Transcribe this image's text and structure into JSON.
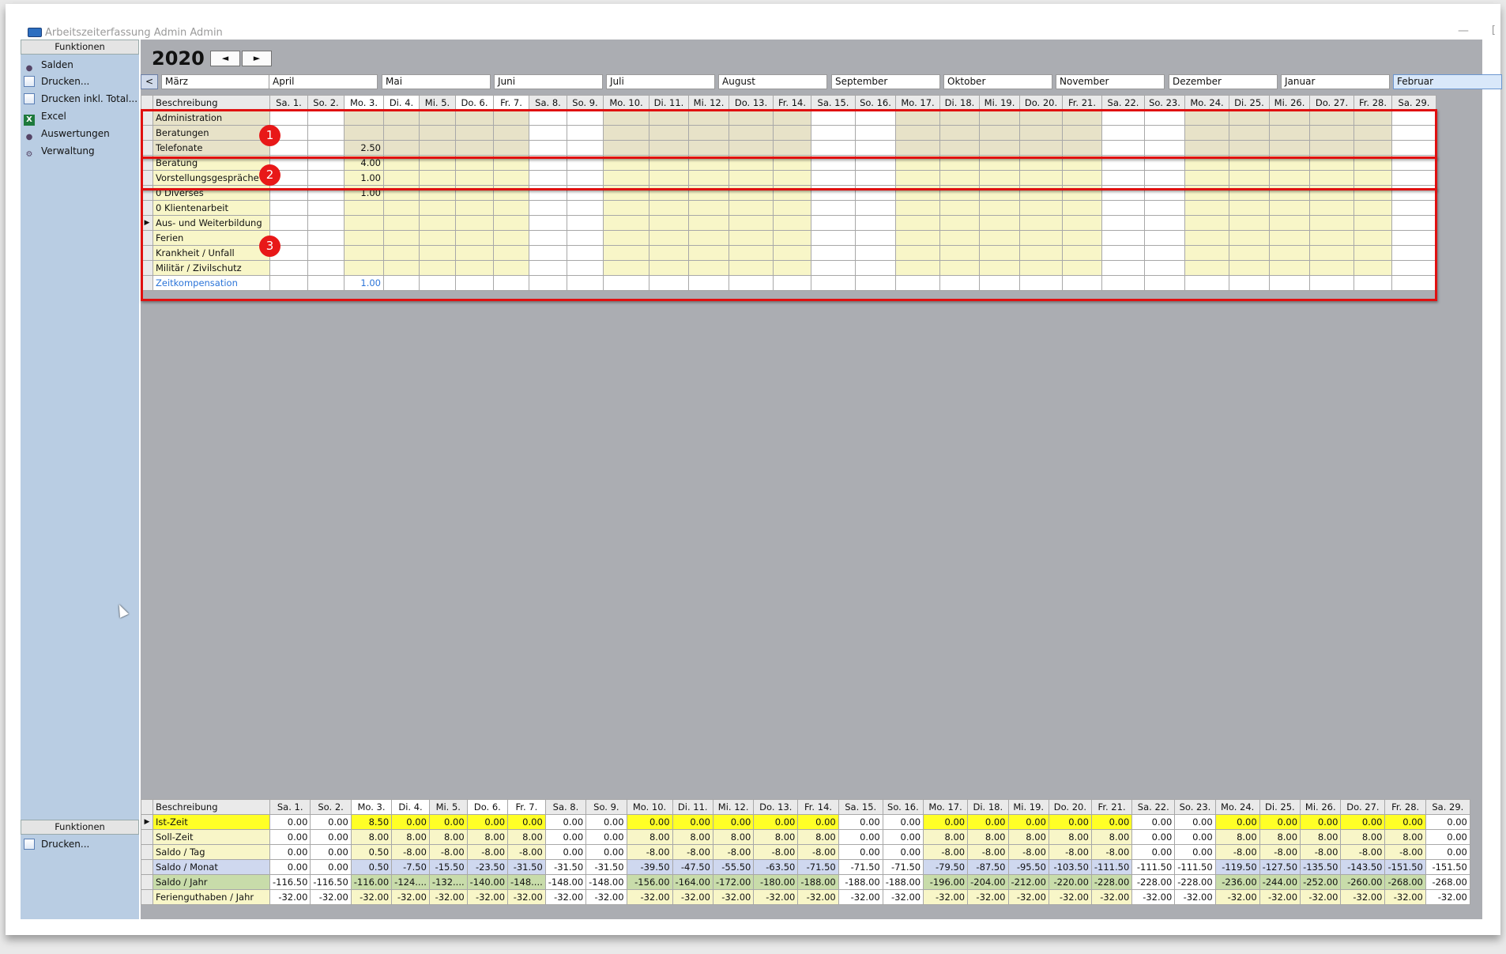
{
  "window": {
    "title": "Arbeitszeiterfassung Admin Admin",
    "minimize": "—",
    "corner": "["
  },
  "sidebar": {
    "header": "Funktionen",
    "items": [
      {
        "label": "Salden",
        "icon": "person-icon"
      },
      {
        "label": "Drucken...",
        "icon": "document-icon"
      },
      {
        "label": "Drucken inkl. Total...",
        "icon": "document-icon"
      },
      {
        "label": "Excel",
        "icon": "excel-icon"
      },
      {
        "label": "Auswertungen",
        "icon": "person-icon"
      },
      {
        "label": "Verwaltung",
        "icon": "gear-icon"
      }
    ],
    "bottom_header": "Funktionen",
    "bottom_items": [
      {
        "label": "Drucken...",
        "icon": "document-icon"
      }
    ]
  },
  "toolbar": {
    "year": "2020",
    "prev_label": "◄",
    "next_label": "►",
    "month_prev_label": "<"
  },
  "months": [
    "März",
    "April",
    "Mai",
    "Juni",
    "Juli",
    "August",
    "September",
    "Oktober",
    "November",
    "Dezember",
    "Januar",
    "Februar"
  ],
  "active_month": "Februar",
  "days": [
    "Sa. 1.",
    "So. 2.",
    "Mo. 3.",
    "Di. 4.",
    "Mi. 5.",
    "Do. 6.",
    "Fr. 7.",
    "Sa. 8.",
    "So. 9.",
    "Mo. 10.",
    "Di. 11.",
    "Mi. 12.",
    "Do. 13.",
    "Fr. 14.",
    "Sa. 15.",
    "So. 16.",
    "Mo. 17.",
    "Di. 18.",
    "Mi. 19.",
    "Do. 20.",
    "Fr. 21.",
    "Sa. 22.",
    "So. 23.",
    "Mo. 24.",
    "Di. 25.",
    "Mi. 26.",
    "Do. 27.",
    "Fr. 28.",
    "Sa. 29."
  ],
  "top_grid": {
    "desc_header": "Beschreibung",
    "rows": [
      {
        "label": "Administration",
        "group": 1,
        "values": {}
      },
      {
        "label": "Beratungen",
        "group": 1,
        "values": {}
      },
      {
        "label": "Telefonate",
        "group": 1,
        "values": {
          "2": "2.50"
        }
      },
      {
        "label": "Beratung",
        "group": 2,
        "values": {
          "2": "4.00"
        }
      },
      {
        "label": "Vorstellungsgespräche",
        "group": 2,
        "values": {
          "2": "1.00"
        }
      },
      {
        "label": "0 Diverses",
        "group": 3,
        "values": {
          "2": "1.00"
        }
      },
      {
        "label": "0 Klientenarbeit",
        "group": 3,
        "values": {}
      },
      {
        "label": "Aus- und Weiterbildung",
        "group": 3,
        "values": {},
        "selected": true
      },
      {
        "label": "Ferien",
        "group": 3,
        "values": {}
      },
      {
        "label": "Krankheit / Unfall",
        "group": 3,
        "values": {}
      },
      {
        "label": "Militär / Zivilschutz",
        "group": 3,
        "values": {}
      },
      {
        "label": "Zeitkompensation",
        "group": 3,
        "values": {
          "2": "1.00"
        },
        "link": true
      }
    ]
  },
  "callouts": [
    "1",
    "2",
    "3"
  ],
  "bottom_grid": {
    "desc_header": "Beschreibung",
    "rows": [
      {
        "label": "Ist-Zeit",
        "style": "yellow",
        "values": [
          "0.00",
          "0.00",
          "8.50",
          "0.00",
          "0.00",
          "0.00",
          "0.00",
          "0.00",
          "0.00",
          "0.00",
          "0.00",
          "0.00",
          "0.00",
          "0.00",
          "0.00",
          "0.00",
          "0.00",
          "0.00",
          "0.00",
          "0.00",
          "0.00",
          "0.00",
          "0.00",
          "0.00",
          "0.00",
          "0.00",
          "0.00",
          "0.00",
          "0.00"
        ]
      },
      {
        "label": "Soll-Zeit",
        "style": "cream",
        "values": [
          "0.00",
          "0.00",
          "8.00",
          "8.00",
          "8.00",
          "8.00",
          "8.00",
          "0.00",
          "0.00",
          "8.00",
          "8.00",
          "8.00",
          "8.00",
          "8.00",
          "0.00",
          "0.00",
          "8.00",
          "8.00",
          "8.00",
          "8.00",
          "8.00",
          "0.00",
          "0.00",
          "8.00",
          "8.00",
          "8.00",
          "8.00",
          "8.00",
          "0.00"
        ]
      },
      {
        "label": "Saldo / Tag",
        "style": "cream",
        "values": [
          "0.00",
          "0.00",
          "0.50",
          "-8.00",
          "-8.00",
          "-8.00",
          "-8.00",
          "0.00",
          "0.00",
          "-8.00",
          "-8.00",
          "-8.00",
          "-8.00",
          "-8.00",
          "0.00",
          "0.00",
          "-8.00",
          "-8.00",
          "-8.00",
          "-8.00",
          "-8.00",
          "0.00",
          "0.00",
          "-8.00",
          "-8.00",
          "-8.00",
          "-8.00",
          "-8.00",
          "0.00"
        ]
      },
      {
        "label": "Saldo / Monat",
        "style": "lav",
        "values": [
          "0.00",
          "0.00",
          "0.50",
          "-7.50",
          "-15.50",
          "-23.50",
          "-31.50",
          "-31.50",
          "-31.50",
          "-39.50",
          "-47.50",
          "-55.50",
          "-63.50",
          "-71.50",
          "-71.50",
          "-71.50",
          "-79.50",
          "-87.50",
          "-95.50",
          "-103.50",
          "-111.50",
          "-111.50",
          "-111.50",
          "-119.50",
          "-127.50",
          "-135.50",
          "-143.50",
          "-151.50",
          "-151.50"
        ]
      },
      {
        "label": "Saldo / Jahr",
        "style": "green",
        "values": [
          "-116.50",
          "-116.50",
          "-116.00",
          "-124....",
          "-132....",
          "-140.00",
          "-148....",
          "-148.00",
          "-148.00",
          "-156.00",
          "-164.00",
          "-172.00",
          "-180.00",
          "-188.00",
          "-188.00",
          "-188.00",
          "-196.00",
          "-204.00",
          "-212.00",
          "-220.00",
          "-228.00",
          "-228.00",
          "-228.00",
          "-236.00",
          "-244.00",
          "-252.00",
          "-260.00",
          "-268.00",
          "-268.00"
        ]
      },
      {
        "label": "Feriengut­haben / Jahr",
        "style": "cream",
        "values": [
          "-32.00",
          "-32.00",
          "-32.00",
          "-32.00",
          "-32.00",
          "-32.00",
          "-32.00",
          "-32.00",
          "-32.00",
          "-32.00",
          "-32.00",
          "-32.00",
          "-32.00",
          "-32.00",
          "-32.00",
          "-32.00",
          "-32.00",
          "-32.00",
          "-32.00",
          "-32.00",
          "-32.00",
          "-32.00",
          "-32.00",
          "-32.00",
          "-32.00",
          "-32.00",
          "-32.00",
          "-32.00",
          "-32.00"
        ]
      }
    ]
  },
  "colors": {
    "sidebar": "#b9cde3",
    "workspace": "#abadb2",
    "callout": "#e01010",
    "yellow": "#ffff26",
    "link": "#2b74d8"
  }
}
